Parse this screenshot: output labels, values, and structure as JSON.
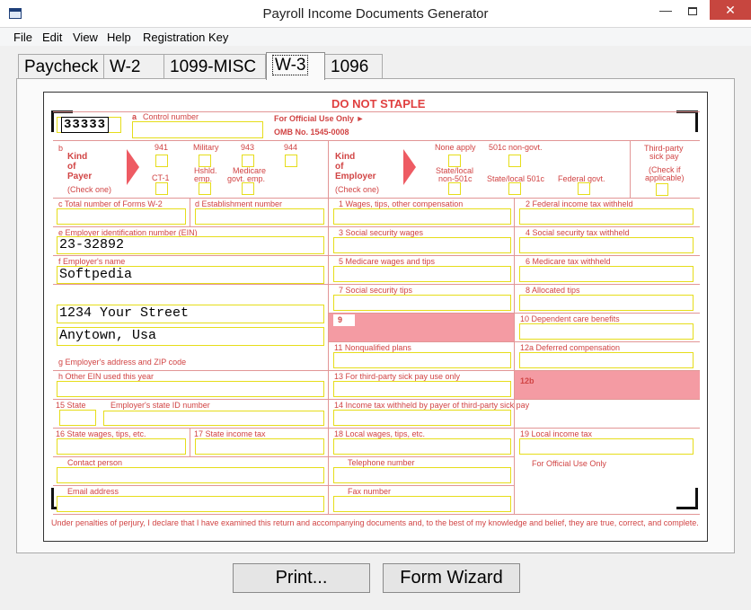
{
  "window": {
    "title": "Payroll Income Documents Generator",
    "minimize": "—",
    "close": "✕"
  },
  "menu": [
    "File",
    "Edit",
    "View",
    "Help",
    "Registration Key"
  ],
  "tabs": [
    "Paycheck",
    "W-2",
    "1099-MISC",
    "W-3",
    "1096"
  ],
  "form": {
    "do_not_staple": "DO NOT STAPLE",
    "control_number_value": "33333",
    "a_label": "a",
    "control_number": "Control number",
    "official_use": "For Official Use Only ►",
    "omb": "OMB No. 1545-0008",
    "b_label": "b",
    "kind_of": "Kind",
    "of": "of",
    "payer": "Payer",
    "check_one": "(Check one)",
    "payer_941": "941",
    "payer_military": "Military",
    "payer_943": "943",
    "payer_944": "944",
    "payer_ct1": "CT-1",
    "payer_hshld": "Hshld.",
    "payer_emp": "emp.",
    "payer_medicare": "Medicare",
    "payer_govt_emp": "govt. emp.",
    "kind2": "Kind",
    "of2": "of",
    "employer": "Employer",
    "check_one2": "(Check one)",
    "none_apply": "None apply",
    "c501_nongovt": "501c non-govt.",
    "state_local": "State/local",
    "non501c": "non-501c",
    "state_local501c": "State/local 501c",
    "federal_govt": "Federal govt.",
    "third_party": "Third-party",
    "sick_pay": "sick pay",
    "check_if": "(Check if",
    "applicable": "applicable)",
    "c_total": "c Total number of Forms W-2",
    "d_establishment": "d Establishment number",
    "box1": "1  Wages, tips, other compensation",
    "box2": "2  Federal income tax withheld",
    "e_ein": "e Employer identification number (EIN)",
    "ein_value": "23-32892",
    "box3": "3  Social security wages",
    "box4": "4  Social security tax withheld",
    "f_name": "f  Employer's name",
    "name_value": "Softpedia",
    "box5": "5  Medicare wages and tips",
    "box6": "6  Medicare tax withheld",
    "box7": "7  Social security tips",
    "box8": "8  Allocated tips",
    "address1_value": "1234 Your Street",
    "box9": "9",
    "box10": "10  Dependent care benefits",
    "address2_value": "Anytown, Usa",
    "box11": "11  Nonqualified plans",
    "box12a": "12a  Deferred compensation",
    "g_address": "g  Employer's address and ZIP code",
    "h_other_ein": "h  Other EIN used this year",
    "box13": "13  For third-party sick pay use only",
    "box12b": "12b",
    "box15": "15  State",
    "state_id": "Employer's state ID number",
    "box14": "14  Income tax withheld by payer of third-party sick pay",
    "box16": "16  State wages, tips, etc.",
    "box17": "17  State income tax",
    "box18": "18  Local wages, tips, etc.",
    "box19": "19  Local income tax",
    "contact": "Contact person",
    "telephone": "Telephone number",
    "official_use2": "For Official Use Only",
    "email": "Email address",
    "fax": "Fax number",
    "perjury": "Under penalties of perjury, I declare that I have examined this return and accompanying documents and, to the best of my knowledge and belief, they are true, correct, and complete."
  },
  "buttons": {
    "print": "Print...",
    "wizard": "Form Wizard"
  }
}
